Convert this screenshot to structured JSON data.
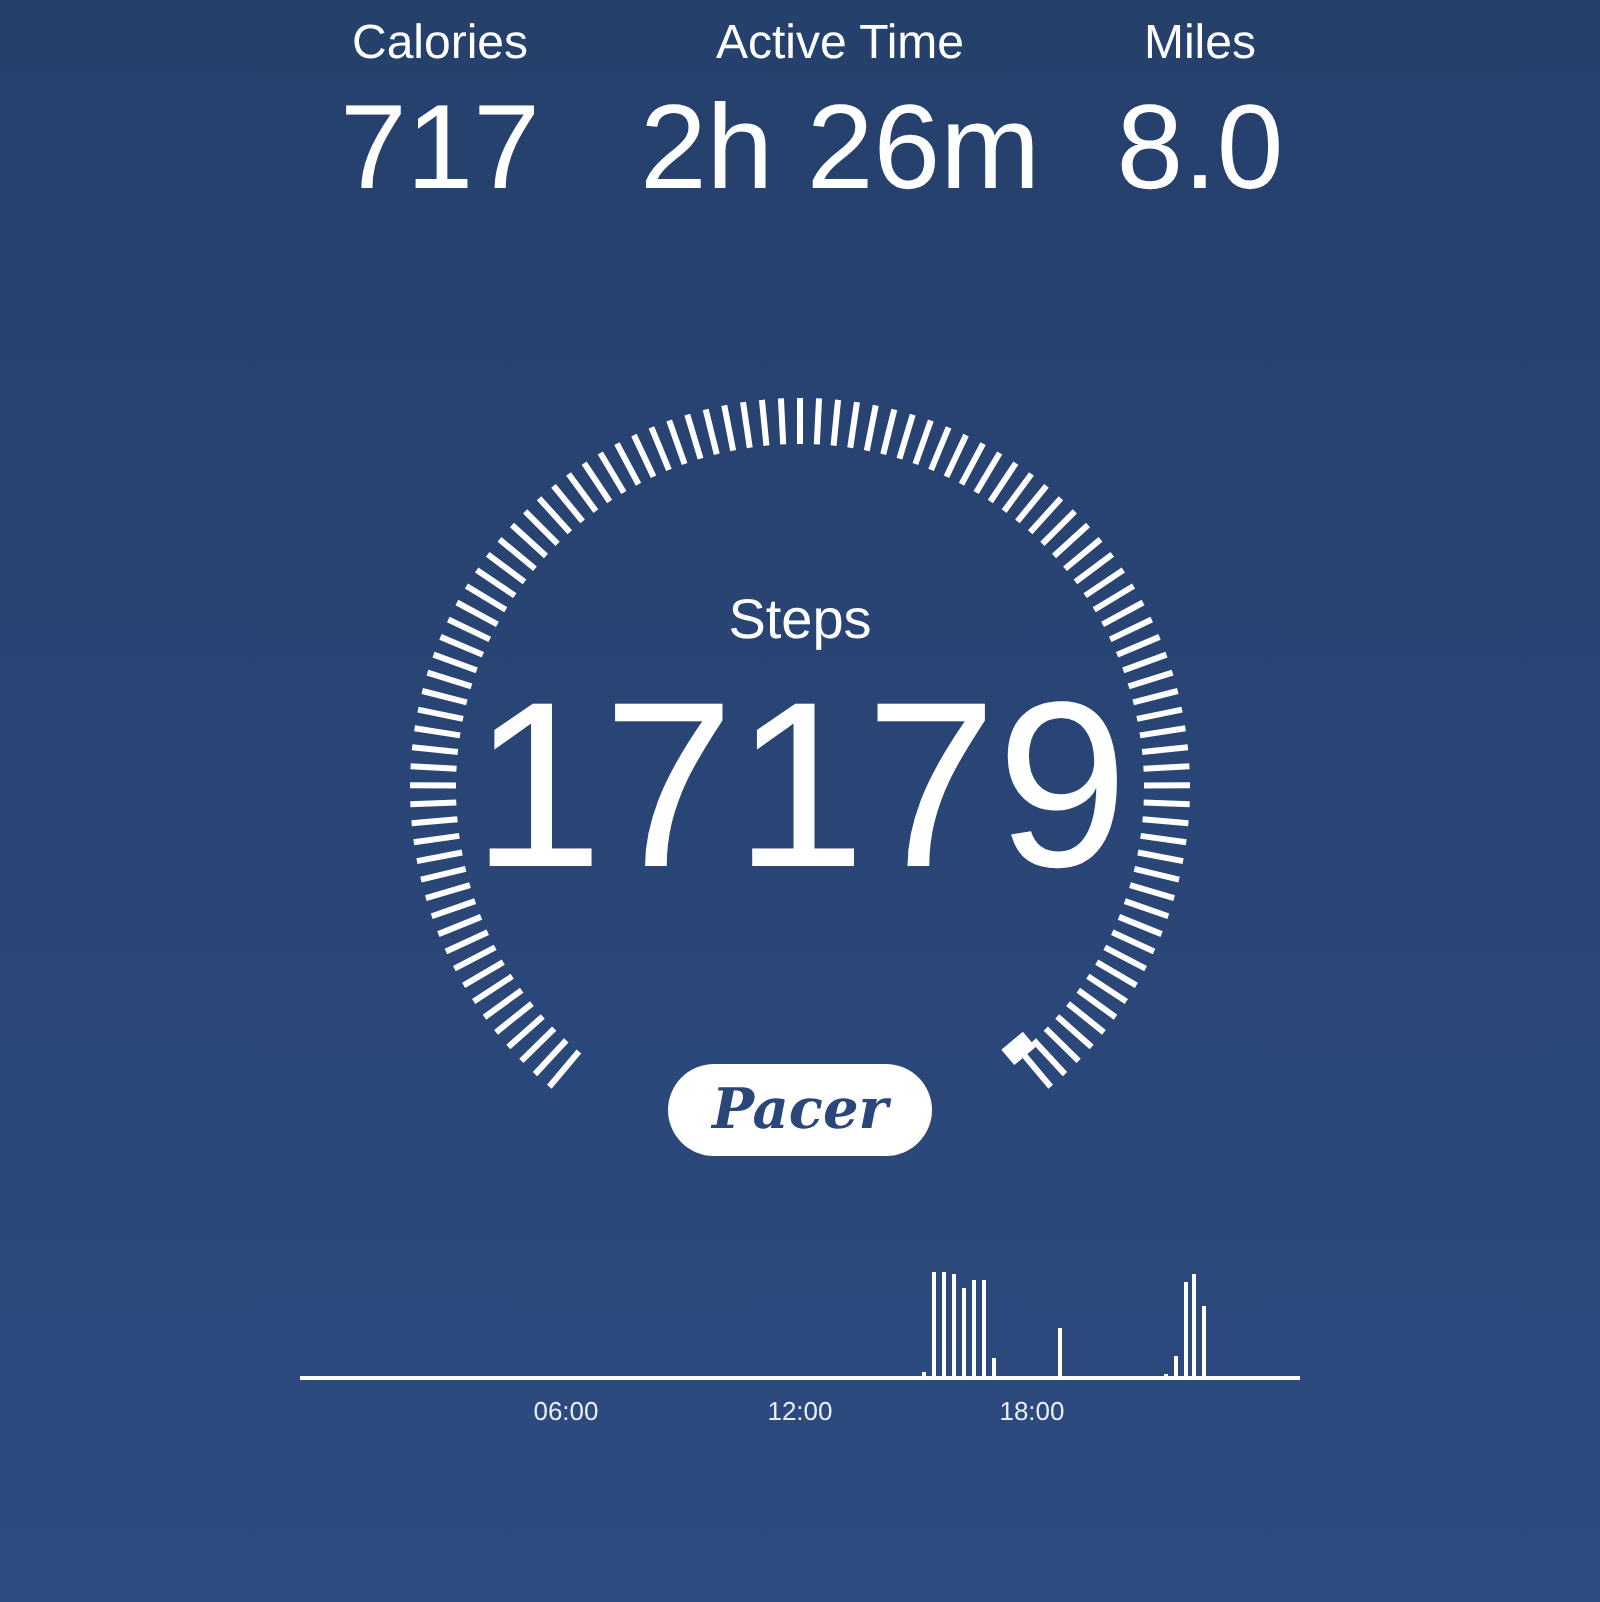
{
  "stats": [
    {
      "label": "Calories",
      "value": "717"
    },
    {
      "label": "Active Time",
      "value": "2h 26m"
    },
    {
      "label": "Miles",
      "value": "8.0"
    }
  ],
  "gauge": {
    "label": "Steps",
    "value": "17179"
  },
  "badge": {
    "text": "Pacer"
  },
  "activity_chart": {
    "time_labels": [
      "06:00",
      "12:00",
      "18:00"
    ]
  }
}
